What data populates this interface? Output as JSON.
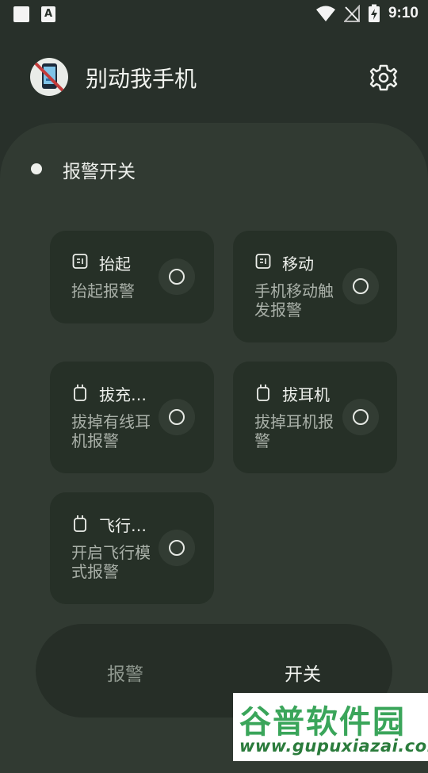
{
  "status_bar": {
    "time": "9:10",
    "icons": [
      "square-notification-icon",
      "font-notification-icon",
      "wifi-icon",
      "no-signal-icon",
      "battery-charging-icon"
    ]
  },
  "app_bar": {
    "title": "别动我手机",
    "logo_icon": "no-phone-logo-icon",
    "settings_icon": "gear-icon"
  },
  "panel": {
    "switch_label": "报警开关"
  },
  "cards": [
    {
      "title": "抬起",
      "desc": "抬起报警",
      "icon": "sensor-icon",
      "checked": false
    },
    {
      "title": "移动",
      "desc": "手机移动触发报警",
      "icon": "sensor-icon",
      "checked": false
    },
    {
      "title": "拔充…",
      "desc": "拔掉有线耳机报警",
      "icon": "plug-icon",
      "checked": false
    },
    {
      "title": "拔耳机",
      "desc": "拔掉耳机报警",
      "icon": "plug-icon",
      "checked": false
    },
    {
      "title": "飞行…",
      "desc": "开启飞行模式报警",
      "icon": "plug-icon",
      "checked": false
    }
  ],
  "bottom_nav": {
    "items": [
      {
        "label": "报警",
        "active": false
      },
      {
        "label": "开关",
        "active": true
      }
    ]
  },
  "watermark": {
    "title": "谷普软件园",
    "url": "www.gupuxiazai.com"
  },
  "colors": {
    "background": "#28302a",
    "panel": "#313a32",
    "card": "#263027",
    "text": "#eef0ec",
    "muted_text": "#a9b0a8",
    "watermark_green": "#3aa55a"
  }
}
